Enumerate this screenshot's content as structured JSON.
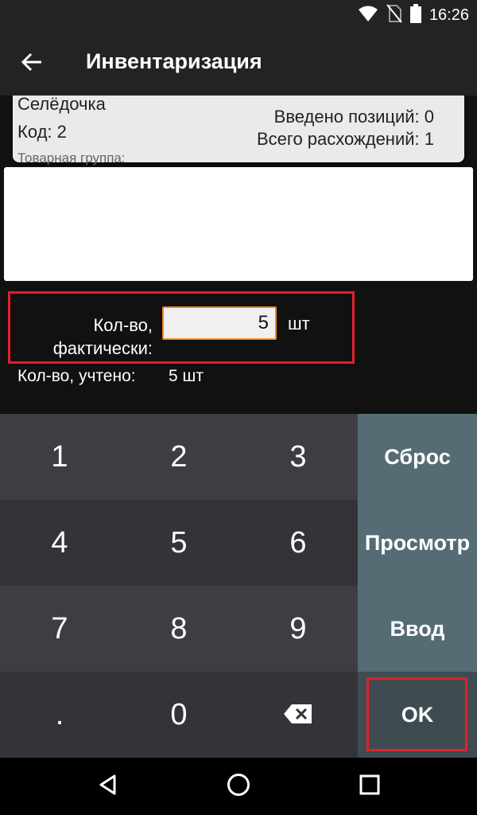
{
  "status_bar": {
    "time": "16:26",
    "icons": [
      "wifi-icon",
      "no-sim-icon",
      "battery-icon"
    ]
  },
  "app_bar": {
    "title": "Инвентаризация",
    "back_icon": "arrow-back-icon"
  },
  "summary": {
    "entered_positions": "Введено позиций: 0",
    "total_discrepancies": "Всего расхождений: 1"
  },
  "product": {
    "name": "Селёдочка",
    "code": "Код: 2",
    "group": "Товарная группа:"
  },
  "quantity": {
    "actual_label_line1": "Кол-во,",
    "actual_label_line2": "фактически:",
    "actual_value": "5",
    "unit": "шт",
    "counted_label": "Кол-во, учтено:",
    "counted_value": "5 шт"
  },
  "keypad": {
    "digits": [
      "1",
      "2",
      "3",
      "4",
      "5",
      "6",
      "7",
      "8",
      "9",
      ".",
      "0"
    ],
    "backspace_icon": "backspace-icon",
    "reset": "Сброс",
    "preview": "Просмотр",
    "enter": "Ввод",
    "ok": "OK"
  },
  "nav_bar": {
    "icons": [
      "back-triangle-icon",
      "home-circle-icon",
      "recents-square-icon"
    ]
  },
  "colors": {
    "background": "#111111",
    "app_bar": "#232323",
    "key_dark": "#3d3e44",
    "key_action": "#566c74",
    "input_border": "#f08a1e",
    "highlight": "#e0202a"
  }
}
